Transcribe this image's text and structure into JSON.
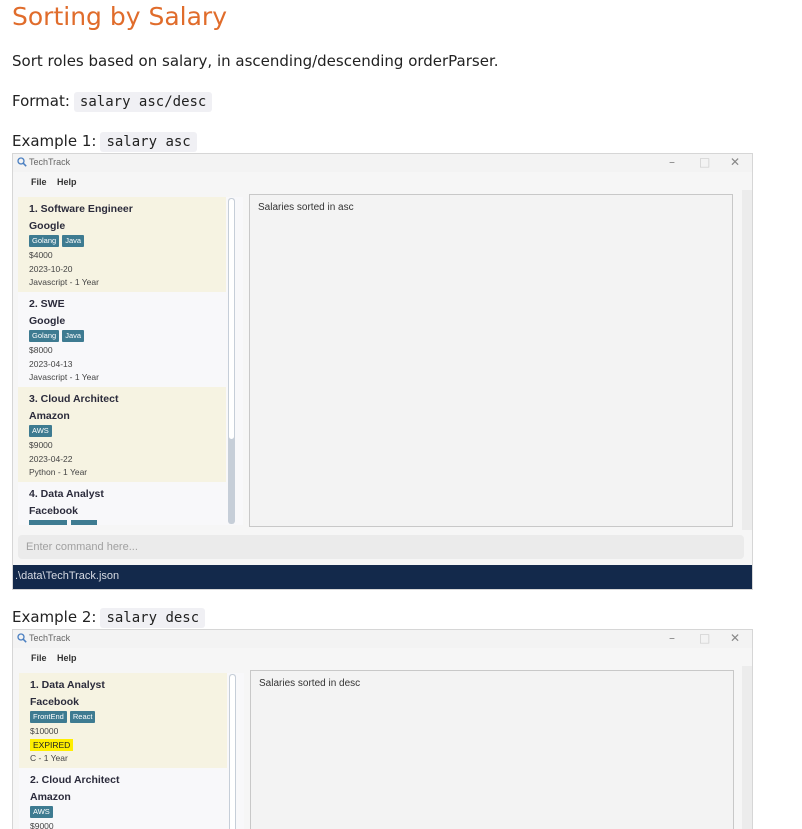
{
  "heading": "Sorting by Salary",
  "description": "Sort roles based on salary, in ascending/descending orderParser.",
  "format": {
    "label": "Format:",
    "code": "salary asc/desc"
  },
  "example1": {
    "label": "Example 1:",
    "code": "salary asc",
    "window": {
      "title": "TechTrack",
      "menu": [
        "File",
        "Help"
      ],
      "controls": {
        "minimize": "–",
        "maximize": "□",
        "close": "✕"
      },
      "result": "Salaries sorted in asc",
      "command_placeholder": "Enter command here...",
      "status": ".\\data\\TechTrack.json",
      "roles": [
        {
          "title": "1.  Software Engineer",
          "company": "Google",
          "tags": [
            "Golang",
            "Java"
          ],
          "salary": "$4000",
          "date": "2023-10-20",
          "extra": "Javascript - 1 Year"
        },
        {
          "title": "2.  SWE",
          "company": "Google",
          "tags": [
            "Golang",
            "Java"
          ],
          "salary": "$8000",
          "date": "2023-04-13",
          "extra": "Javascript - 1 Year"
        },
        {
          "title": "3.  Cloud Architect",
          "company": "Amazon",
          "tags": [
            "AWS"
          ],
          "salary": "$9000",
          "date": "2023-04-22",
          "extra": "Python - 1 Year"
        },
        {
          "title": "4.  Data Analyst",
          "company": "Facebook"
        }
      ]
    }
  },
  "example2": {
    "label": "Example 2:",
    "code": "salary desc",
    "window": {
      "title": "TechTrack",
      "menu": [
        "File",
        "Help"
      ],
      "controls": {
        "minimize": "–",
        "maximize": "□",
        "close": "✕"
      },
      "result": "Salaries sorted in desc",
      "roles": [
        {
          "title": "1.  Data Analyst",
          "company": "Facebook",
          "tags": [
            "FrontEnd",
            "React"
          ],
          "salary": "$10000",
          "badge": "EXPIRED",
          "extra": "C - 1 Year"
        },
        {
          "title": "2.  Cloud Architect",
          "company": "Amazon",
          "tags": [
            "AWS"
          ],
          "salary": "$9000"
        }
      ]
    }
  },
  "colors": {
    "heading": "#e06c2b",
    "tag": "#3e7b91",
    "status_bar": "#13294b",
    "expired": "#ffee00",
    "card_highlight": "#f6f3e2"
  }
}
